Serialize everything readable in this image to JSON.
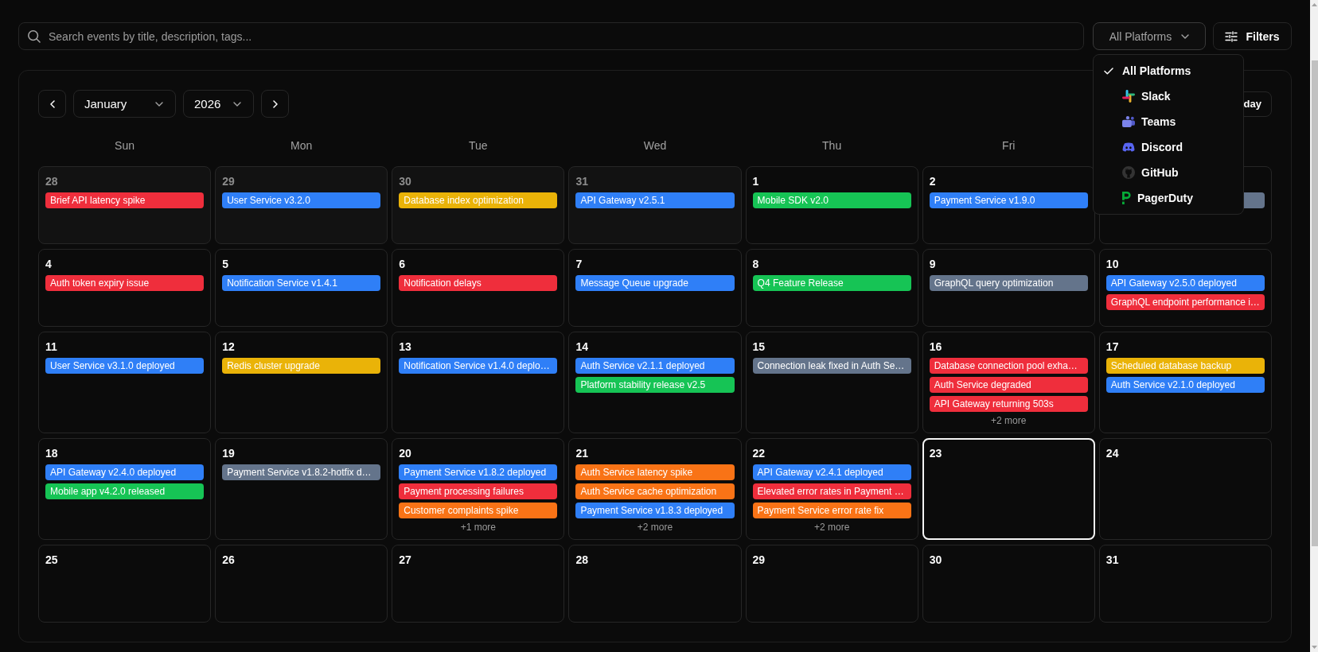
{
  "search": {
    "placeholder": "Search events by title, description, tags..."
  },
  "platform_select": {
    "value": "All Platforms",
    "expanded": true,
    "options": [
      {
        "label": "All Platforms",
        "kind": "all",
        "selected": true
      },
      {
        "label": "Slack",
        "kind": "slack",
        "selected": false
      },
      {
        "label": "Teams",
        "kind": "teams",
        "selected": false
      },
      {
        "label": "Discord",
        "kind": "discord",
        "selected": false
      },
      {
        "label": "GitHub",
        "kind": "github",
        "selected": false
      },
      {
        "label": "PagerDuty",
        "kind": "pagerduty",
        "selected": false
      }
    ]
  },
  "filters_button": {
    "label": "Filters"
  },
  "calendar": {
    "month_select": {
      "value": "January"
    },
    "year_select": {
      "value": "2026"
    },
    "today_button": {
      "label": "day"
    },
    "weekdays": [
      "Sun",
      "Mon",
      "Tue",
      "Wed",
      "Thu",
      "Fri"
    ],
    "days": [
      {
        "date": "28",
        "in_month": false,
        "today": false,
        "events": [
          {
            "title": "Brief API latency spike",
            "color": "#ef2e3c"
          }
        ]
      },
      {
        "date": "29",
        "in_month": false,
        "today": false,
        "events": [
          {
            "title": "User Service v3.2.0",
            "color": "#2f7ff7"
          }
        ]
      },
      {
        "date": "30",
        "in_month": false,
        "today": false,
        "events": [
          {
            "title": "Database index optimization",
            "color": "#eab308"
          }
        ]
      },
      {
        "date": "31",
        "in_month": false,
        "today": false,
        "events": [
          {
            "title": "API Gateway v2.5.1",
            "color": "#2f7ff7"
          }
        ]
      },
      {
        "date": "1",
        "in_month": true,
        "today": false,
        "events": [
          {
            "title": "Mobile SDK v2.0",
            "color": "#16c455"
          }
        ]
      },
      {
        "date": "2",
        "in_month": true,
        "today": false,
        "events": [
          {
            "title": "Payment Service v1.9.0",
            "color": "#2f7ff7"
          }
        ]
      },
      {
        "in_month": true,
        "today": false,
        "events": [
          {
            "color": "#64748b"
          }
        ]
      },
      {
        "date": "4",
        "in_month": true,
        "today": false,
        "events": [
          {
            "title": "Auth token expiry issue",
            "color": "#ef2e3c"
          }
        ]
      },
      {
        "date": "5",
        "in_month": true,
        "today": false,
        "events": [
          {
            "title": "Notification Service v1.4.1",
            "color": "#2f7ff7"
          }
        ]
      },
      {
        "date": "6",
        "in_month": true,
        "today": false,
        "events": [
          {
            "title": "Notification delays",
            "color": "#ef2e3c"
          }
        ]
      },
      {
        "date": "7",
        "in_month": true,
        "today": false,
        "events": [
          {
            "title": "Message Queue upgrade",
            "color": "#2f7ff7"
          }
        ]
      },
      {
        "date": "8",
        "in_month": true,
        "today": false,
        "events": [
          {
            "title": "Q4 Feature Release",
            "color": "#16c455"
          }
        ]
      },
      {
        "date": "9",
        "in_month": true,
        "today": false,
        "events": [
          {
            "title": "GraphQL query optimization",
            "color": "#64748b"
          }
        ]
      },
      {
        "date": "10",
        "in_month": true,
        "today": false,
        "events": [
          {
            "title": "API Gateway v2.5.0 deployed",
            "color": "#2f7ff7"
          },
          {
            "title": "GraphQL endpoint performance i…",
            "color": "#ef2e3c"
          }
        ]
      },
      {
        "date": "11",
        "in_month": true,
        "today": false,
        "events": [
          {
            "title": "User Service v3.1.0 deployed",
            "color": "#2f7ff7"
          }
        ]
      },
      {
        "date": "12",
        "in_month": true,
        "today": false,
        "events": [
          {
            "title": "Redis cluster upgrade",
            "color": "#eab308"
          }
        ]
      },
      {
        "date": "13",
        "in_month": true,
        "today": false,
        "events": [
          {
            "title": "Notification Service v1.4.0 deplo…",
            "color": "#2f7ff7"
          }
        ]
      },
      {
        "date": "14",
        "in_month": true,
        "today": false,
        "events": [
          {
            "title": "Auth Service v2.1.1 deployed",
            "color": "#2f7ff7"
          },
          {
            "title": "Platform stability release v2.5",
            "color": "#16c455"
          }
        ]
      },
      {
        "date": "15",
        "in_month": true,
        "today": false,
        "events": [
          {
            "title": "Connection leak fixed in Auth Se…",
            "color": "#64748b"
          }
        ]
      },
      {
        "date": "16",
        "in_month": true,
        "today": false,
        "events": [
          {
            "title": "Database connection pool exha…",
            "color": "#ef2e3c"
          },
          {
            "title": "Auth Service degraded",
            "color": "#ef2e3c"
          },
          {
            "title": "API Gateway returning 503s",
            "color": "#ef2e3c"
          }
        ],
        "more": "+2 more"
      },
      {
        "date": "17",
        "in_month": true,
        "today": false,
        "events": [
          {
            "title": "Scheduled database backup",
            "color": "#eab308"
          },
          {
            "title": "Auth Service v2.1.0 deployed",
            "color": "#2f7ff7"
          }
        ]
      },
      {
        "date": "18",
        "in_month": true,
        "today": false,
        "events": [
          {
            "title": "API Gateway v2.4.0 deployed",
            "color": "#2f7ff7"
          },
          {
            "title": "Mobile app v4.2.0 released",
            "color": "#16c455"
          }
        ]
      },
      {
        "date": "19",
        "in_month": true,
        "today": false,
        "events": [
          {
            "title": "Payment Service v1.8.2-hotfix d…",
            "color": "#64748b"
          }
        ]
      },
      {
        "date": "20",
        "in_month": true,
        "today": false,
        "events": [
          {
            "title": "Payment Service v1.8.2 deployed",
            "color": "#2f7ff7"
          },
          {
            "title": "Payment processing failures",
            "color": "#ef2e3c"
          },
          {
            "title": "Customer complaints spike",
            "color": "#f97316"
          }
        ],
        "more": "+1 more"
      },
      {
        "date": "21",
        "in_month": true,
        "today": false,
        "events": [
          {
            "title": "Auth Service latency spike",
            "color": "#f97316"
          },
          {
            "title": "Auth Service cache optimization",
            "color": "#f97316"
          },
          {
            "title": "Payment Service v1.8.3 deployed",
            "color": "#2f7ff7"
          }
        ],
        "more": "+2 more"
      },
      {
        "date": "22",
        "in_month": true,
        "today": false,
        "events": [
          {
            "title": "API Gateway v2.4.1 deployed",
            "color": "#2f7ff7"
          },
          {
            "title": "Elevated error rates in Payment …",
            "color": "#ef2e3c"
          },
          {
            "title": "Payment Service error rate fix",
            "color": "#f97316"
          }
        ],
        "more": "+2 more"
      },
      {
        "date": "23",
        "in_month": true,
        "today": true
      },
      {
        "date": "24",
        "in_month": true,
        "today": false
      },
      {
        "date": "25",
        "in_month": true,
        "today": false
      },
      {
        "date": "26",
        "in_month": true,
        "today": false
      },
      {
        "date": "27",
        "in_month": true,
        "today": false
      },
      {
        "date": "28",
        "in_month": true,
        "today": false
      },
      {
        "date": "29",
        "in_month": true,
        "today": false
      },
      {
        "date": "30",
        "in_month": true,
        "today": false
      },
      {
        "date": "31",
        "in_month": true,
        "today": false
      }
    ]
  }
}
